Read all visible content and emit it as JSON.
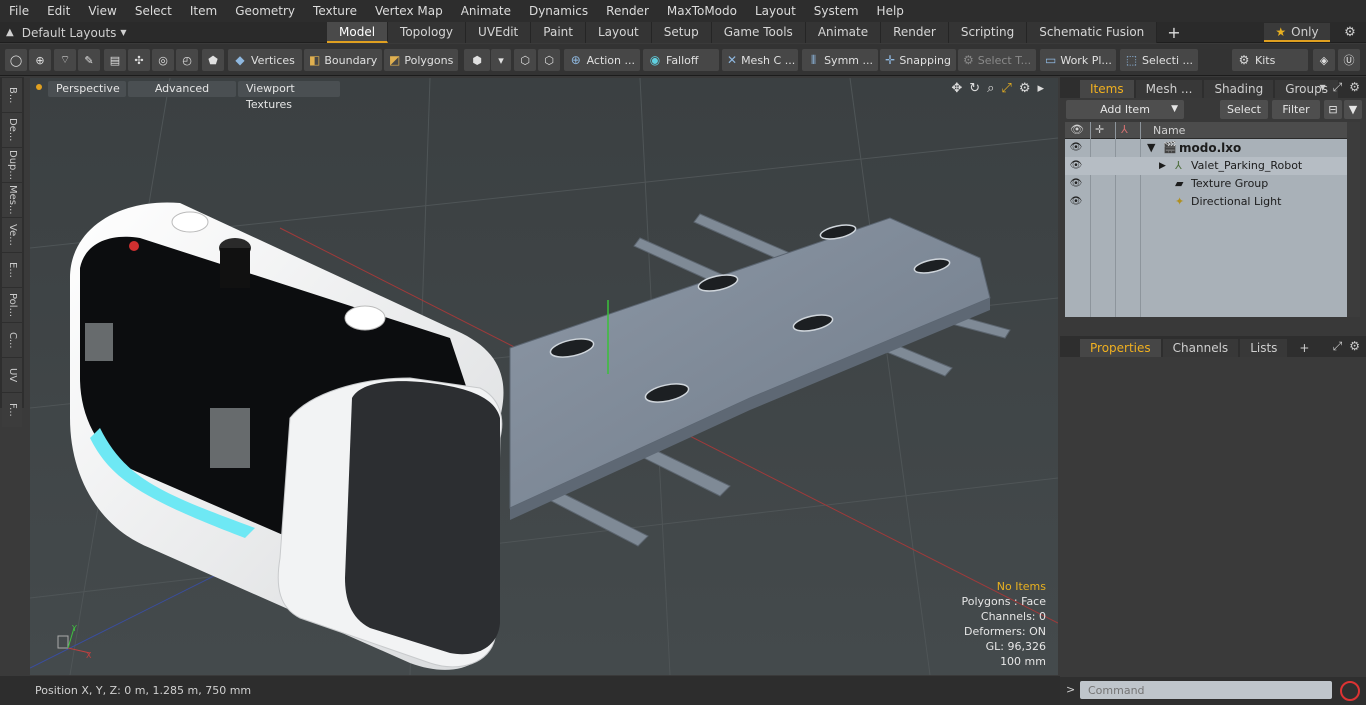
{
  "menu": [
    "File",
    "Edit",
    "View",
    "Select",
    "Item",
    "Geometry",
    "Texture",
    "Vertex Map",
    "Animate",
    "Dynamics",
    "Render",
    "MaxToModo",
    "Layout",
    "System",
    "Help"
  ],
  "layout_dropdown": "Default Layouts",
  "tabs": [
    {
      "label": "Model",
      "active": true
    },
    {
      "label": "Topology"
    },
    {
      "label": "UVEdit"
    },
    {
      "label": "Paint"
    },
    {
      "label": "Layout"
    },
    {
      "label": "Setup"
    },
    {
      "label": "Game Tools"
    },
    {
      "label": "Animate"
    },
    {
      "label": "Render"
    },
    {
      "label": "Scripting"
    },
    {
      "label": "Schematic Fusion"
    }
  ],
  "only_label": "Only",
  "toolbar": {
    "vertices": "Vertices",
    "boundary": "Boundary",
    "polygons": "Polygons",
    "action": "Action ...",
    "falloff": "Falloff",
    "mesh": "Mesh C ...",
    "symmetry": "Symm ...",
    "snapping": "Snapping",
    "select_t": "Select T...",
    "work_plane": "Work Pl...",
    "selection": "Selecti ...",
    "kits": "Kits"
  },
  "left_strip": [
    "B...",
    "De...",
    "Dup...",
    "Mes...",
    "Ve...",
    "E...",
    "Pol...",
    "C...",
    "UV",
    "F..."
  ],
  "viewport": {
    "perspective": "Perspective",
    "advanced": "Advanced",
    "textures": "Viewport Textures",
    "info": {
      "no_items": "No Items",
      "polygons": "Polygons : Face",
      "channels": "Channels: 0",
      "deformers": "Deformers: ON",
      "gl": "GL: 96,326",
      "scale": "100 mm"
    }
  },
  "status": {
    "position": "Position X, Y, Z:   0 m, 1.285 m, 750 mm"
  },
  "items_panel": {
    "tabs": [
      "Items",
      "Mesh ...",
      "Shading",
      "Groups"
    ],
    "add_item": "Add Item",
    "select": "Select",
    "filter": "Filter",
    "name_header": "Name",
    "tree": [
      {
        "label": "modo.lxo",
        "bold": true
      },
      {
        "label": "Valet_Parking_Robot"
      },
      {
        "label": "Texture Group"
      },
      {
        "label": "Directional Light"
      }
    ]
  },
  "props_panel": {
    "tabs": [
      "Properties",
      "Channels",
      "Lists"
    ]
  },
  "command": {
    "placeholder": "Command"
  },
  "colors": {
    "accent": "#e0a020",
    "viewport_bg": "#3f4446"
  }
}
